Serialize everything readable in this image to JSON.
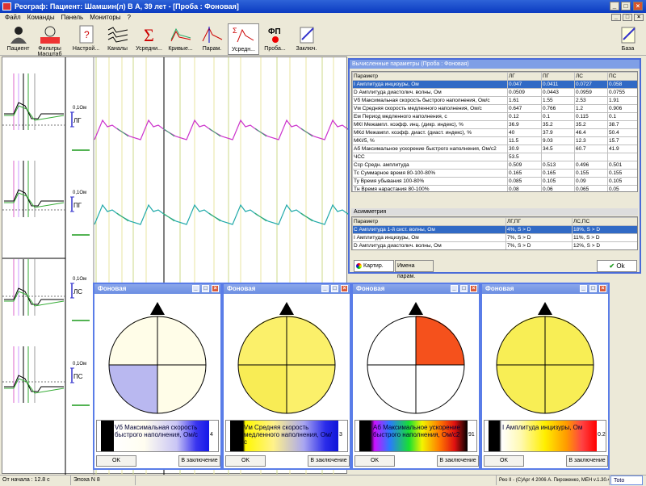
{
  "title": "Реограф: Пациент: Шамшин(л) В А, 39 лет - [Проба : Фоновая]",
  "menu": [
    "Файл",
    "Команды",
    "Панель",
    "Мониторы",
    "?"
  ],
  "toolbar": [
    {
      "label": "Пациент",
      "icon": "patient-icon"
    },
    {
      "label": "Фильтры Масштаб",
      "icon": "filter-scale-icon"
    },
    {
      "label": "Настрой...",
      "icon": "settings-icon"
    },
    {
      "label": "Каналы",
      "icon": "channels-icon"
    },
    {
      "label": "Усредни...",
      "icon": "sigma-icon"
    },
    {
      "label": "Кривые...",
      "icon": "curves-icon"
    },
    {
      "label": "Парам.",
      "icon": "params-icon"
    },
    {
      "label": "Усредн...",
      "icon": "averaged-icon"
    },
    {
      "label": "Проба...",
      "icon": "fp-icon",
      "badge": "ФП"
    },
    {
      "label": "Заключ.",
      "icon": "conclusion-icon"
    },
    {
      "label": "База",
      "icon": "database-icon"
    }
  ],
  "channels": [
    {
      "scale": "0,1Ом",
      "name": "ЛГ"
    },
    {
      "scale": "0,1Ом",
      "name": "ПГ"
    },
    {
      "scale": "0,1Ом",
      "name": "ЛС"
    },
    {
      "scale": "0,1Ом",
      "name": "ПС"
    }
  ],
  "calc_window": {
    "title": "Вычисленные параметры (Проба : Фоновая)",
    "headers": [
      "Параметр",
      "ЛГ",
      "ПГ",
      "ЛС",
      "ПС"
    ],
    "rows": [
      [
        "I  Амплитуда инцизуры, Ом",
        "0.047",
        "0.0411",
        "0.0727",
        "0.058"
      ],
      [
        "D  Амплитуда диастолич. волны, Ом",
        "0.0509",
        "0.0443",
        "0.0959",
        "0.0755"
      ],
      [
        "Vб  Максимальная скорость быстрого наполнения, Ом/с",
        "1.61",
        "1.55",
        "2.53",
        "1.91"
      ],
      [
        "Vм  Средняя скорость медленного наполнения, Ом/с",
        "0.647",
        "0.766",
        "1.2",
        "0.906"
      ],
      [
        "Ем  Период медленного наполнения, с",
        "0.12",
        "0.1",
        "0.115",
        "0.1"
      ],
      [
        "МКI  Межампл. коэфф. инц. (дикр. индекс), %",
        "36.9",
        "35.2",
        "35.2",
        "38.7"
      ],
      [
        "МКd  Межампл. коэфф. диаст. (диаст. индекс), %",
        "40",
        "37.9",
        "46.4",
        "50.4"
      ],
      [
        "МКI/5, %",
        "11.5",
        "9.03",
        "12.3",
        "15.7"
      ],
      [
        "Аб  Максимальное ускорение быстрого наполнения, Ом/с2",
        "30.9",
        "34.5",
        "60.7",
        "41.9"
      ],
      [
        "ЧСС",
        "53.5",
        "",
        "",
        ""
      ],
      [
        "Сср  Средн. амплитуда",
        "0.509",
        "0.513",
        "0.496",
        "0.501"
      ],
      [
        "Тс  Суммарное время 80-100-80%",
        "0.165",
        "0.165",
        "0.155",
        "0.155"
      ],
      [
        "Ту  Время убывания 100-80%",
        "0.085",
        "0.105",
        "0.09",
        "0.105"
      ],
      [
        "Тн  Время нарастания 80-100%",
        "0.08",
        "0.06",
        "0.065",
        "0.05"
      ]
    ],
    "asym_title": "Асимметрия",
    "asym_headers": [
      "Параметр",
      "ЛГ,ПГ",
      "ЛС,ПС"
    ],
    "asym_rows": [
      [
        "С  Амплитуда 1-й сист. волны, Ом",
        "4%, S > D",
        "18%, S > D"
      ],
      [
        "I  Амплитуда инцизуры, Ом",
        "7%, S > D",
        "11%, S > D"
      ],
      [
        "D  Амплитуда диастолич. волны, Ом",
        "7%, S > D",
        "12%, S > D"
      ]
    ],
    "tab_map": "Картир.",
    "tab_names": "Имена парам.",
    "ok": "Ok"
  },
  "popups": [
    {
      "title": "Фоновая",
      "legend": "Vб  Максимальная скорость быстрого наполнения, Ом/с",
      "min": "0",
      "max": "4",
      "q_tl": "#fffde8",
      "q_tr": "#fffde8",
      "q_bl": "#b9b8f0",
      "q_br": "#fffde8",
      "lg": "linear-gradient(90deg,#000 0%,#000 12%,#fff 12%,#fffdf0 40%,#c9c5f5 70%,#3a35ef 88%,#1418e8 100%)"
    },
    {
      "title": "Фоновая",
      "legend": "Vм  Средняя скорость медленного наполнения, Ом/с",
      "min": "0",
      "max": "3",
      "q_tl": "#fbf06a",
      "q_tr": "#fbf06a",
      "q_bl": "#f8ec55",
      "q_br": "#fbf06a",
      "lg": "linear-gradient(90deg,#000 0%,#000 12%,#fff800 14%,#fff28a 40%,#a9a6f0 68%,#2b2cea 88%,#0f14d8 100%)"
    },
    {
      "title": "Фоновая",
      "legend": "Аб  Максимальное ускорение быстрого наполнения, Ом/с2",
      "min": "0",
      "max": "91",
      "q_tl": "#ffffff",
      "q_tr": "#f5511c",
      "q_bl": "#ffffff",
      "q_br": "#ffffff",
      "lg": "linear-gradient(90deg,#000 0%,#000 10%,#cc10ff 14%,#2a7aff 28%,#18e030 46%,#f3f400 58%,#ff7a00 74%,#e01010 88%,#000 100%)"
    },
    {
      "title": "Фоновая",
      "legend": "I  Амплитуда инцизуры, Ом",
      "min": "0",
      "max": "0.2",
      "q_tl": "#f8ee55",
      "q_tr": "#f8ee55",
      "q_bl": "#f8ee55",
      "q_br": "#f8ee55",
      "lg": "linear-gradient(90deg,#000 0%,#000 10%,#fff 12%,#fff9b0 30%,#ffef00 52%,#ff9a00 72%,#f44 86%,#f00 100%)"
    }
  ],
  "popup_ok": "OK",
  "popup_to_conclusion": "В заключение",
  "status": {
    "start": "От начала : 12.8 с",
    "epoch": "Эпоха N 8",
    "copyright": "Рео II - (С)Арг  4 2006 А. Пироженко, МЕН v.1.30.4",
    "toto": "Toto"
  }
}
